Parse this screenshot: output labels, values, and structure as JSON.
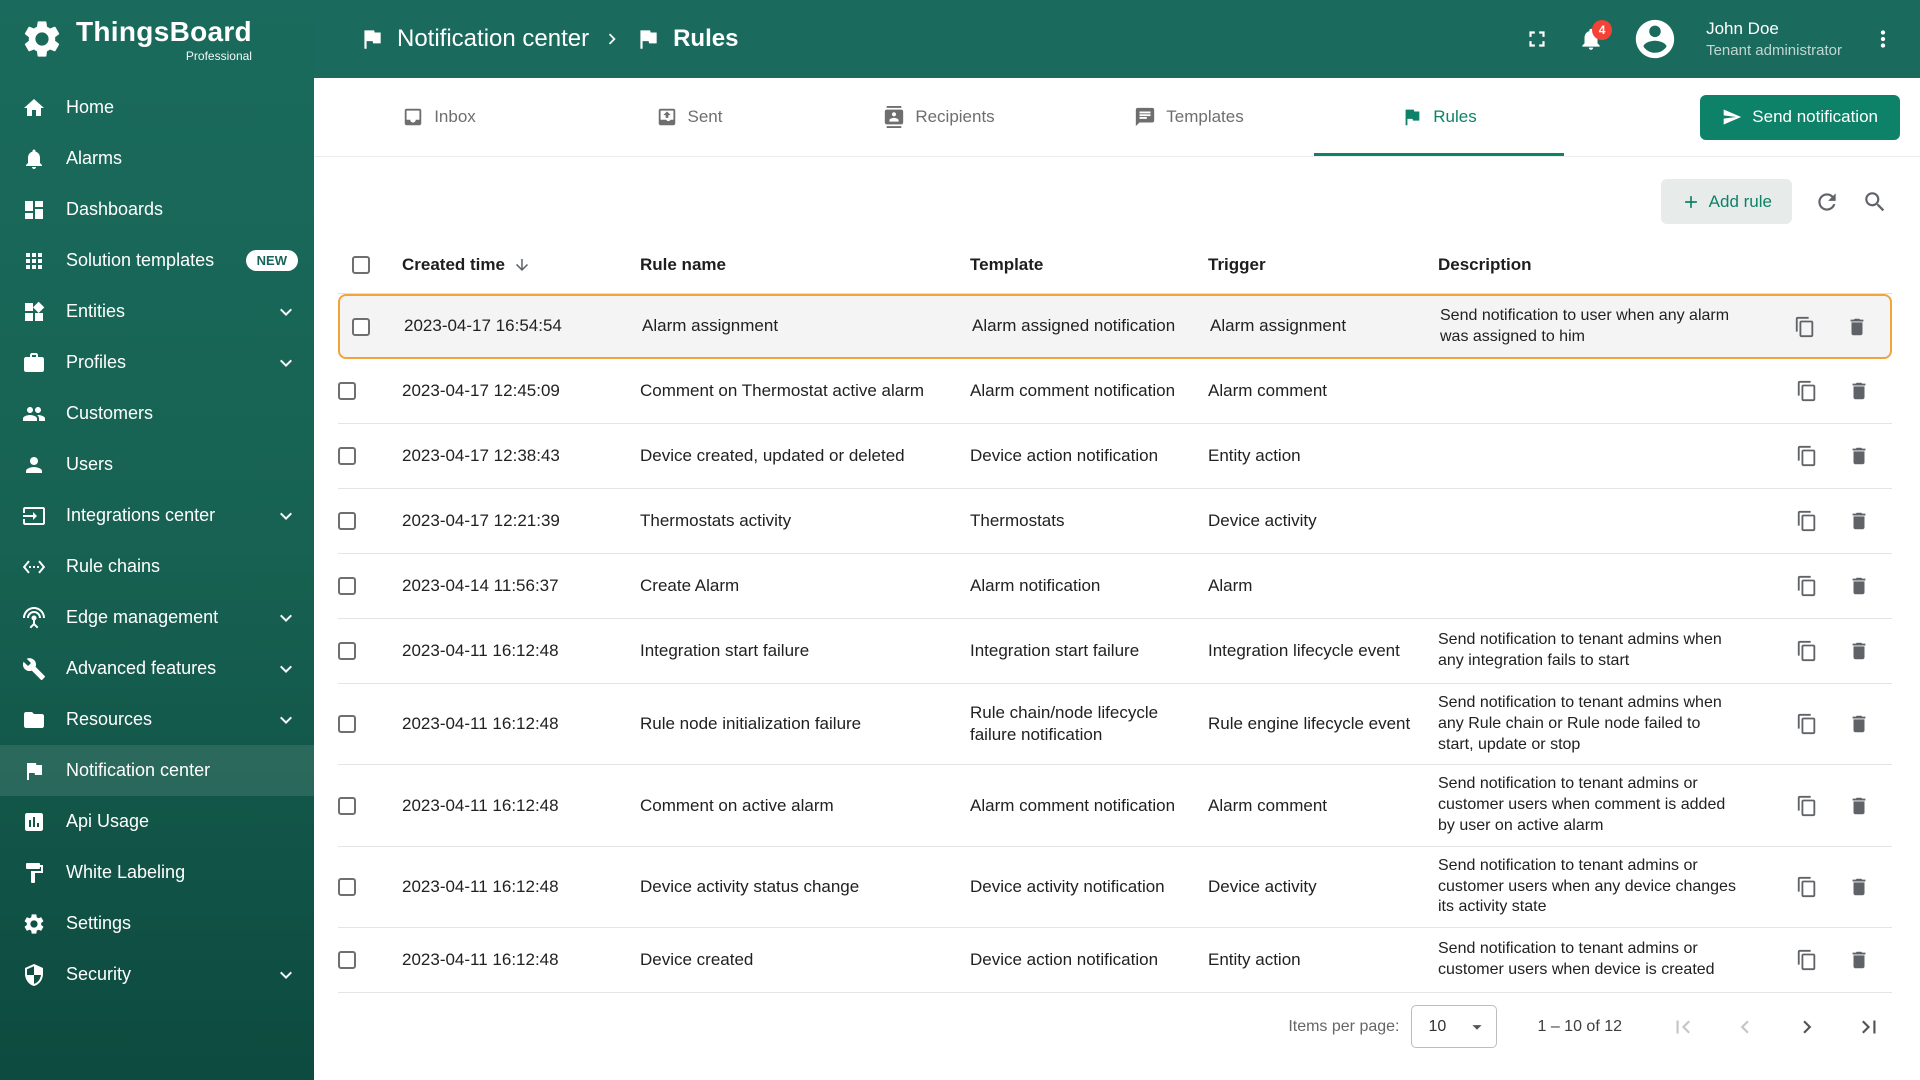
{
  "app": {
    "name": "ThingsBoard",
    "edition": "Professional"
  },
  "colors": {
    "sidebar_green": "#1a6b5d",
    "sidebar_green_dark": "#0d4a3f",
    "accent_green": "#0e8268",
    "highlight_border": "#f1a43c",
    "notification_badge": "#f44336"
  },
  "header": {
    "breadcrumb": [
      {
        "label": "Notification center",
        "icon": "flag"
      },
      {
        "label": "Rules",
        "icon": "rules"
      }
    ],
    "notifications_count": "4",
    "user": {
      "name": "John Doe",
      "role": "Tenant administrator"
    }
  },
  "sidebar": {
    "items": [
      {
        "label": "Home",
        "icon": "home"
      },
      {
        "label": "Alarms",
        "icon": "bell"
      },
      {
        "label": "Dashboards",
        "icon": "dashboard"
      },
      {
        "label": "Solution templates",
        "icon": "apps",
        "badge": "NEW"
      },
      {
        "label": "Entities",
        "icon": "entities",
        "expandable": true
      },
      {
        "label": "Profiles",
        "icon": "briefcase",
        "expandable": true
      },
      {
        "label": "Customers",
        "icon": "people"
      },
      {
        "label": "Users",
        "icon": "person"
      },
      {
        "label": "Integrations center",
        "icon": "integrations",
        "expandable": true
      },
      {
        "label": "Rule chains",
        "icon": "rule-chains"
      },
      {
        "label": "Edge management",
        "icon": "antenna",
        "expandable": true
      },
      {
        "label": "Advanced features",
        "icon": "tools",
        "expandable": true
      },
      {
        "label": "Resources",
        "icon": "folder",
        "expandable": true
      },
      {
        "label": "Notification center",
        "icon": "flag",
        "active": true
      },
      {
        "label": "Api Usage",
        "icon": "chart"
      },
      {
        "label": "White Labeling",
        "icon": "paint"
      },
      {
        "label": "Settings",
        "icon": "gear"
      },
      {
        "label": "Security",
        "icon": "shield",
        "expandable": true
      }
    ]
  },
  "tabs": [
    {
      "label": "Inbox",
      "icon": "inbox"
    },
    {
      "label": "Sent",
      "icon": "outbox"
    },
    {
      "label": "Recipients",
      "icon": "contacts"
    },
    {
      "label": "Templates",
      "icon": "message"
    },
    {
      "label": "Rules",
      "icon": "rules",
      "active": true
    }
  ],
  "actions": {
    "send_notification": "Send notification",
    "add_rule": "Add rule"
  },
  "table": {
    "columns": [
      "Created time",
      "Rule name",
      "Template",
      "Trigger",
      "Description"
    ],
    "sort_column": "Created time",
    "sort_direction": "desc",
    "rows": [
      {
        "created": "2023-04-17 16:54:54",
        "name": "Alarm assignment",
        "template": "Alarm assigned notification",
        "trigger": "Alarm assignment",
        "description": "Send notification to user when any alarm was assigned to him",
        "highlighted": true
      },
      {
        "created": "2023-04-17 12:45:09",
        "name": "Comment on Thermostat active alarm",
        "template": "Alarm comment notification",
        "trigger": "Alarm comment",
        "description": ""
      },
      {
        "created": "2023-04-17 12:38:43",
        "name": "Device created, updated or deleted",
        "template": "Device action notification",
        "trigger": "Entity action",
        "description": ""
      },
      {
        "created": "2023-04-17 12:21:39",
        "name": "Thermostats activity",
        "template": "Thermostats",
        "trigger": "Device activity",
        "description": ""
      },
      {
        "created": "2023-04-14 11:56:37",
        "name": "Create Alarm",
        "template": "Alarm notification",
        "trigger": "Alarm",
        "description": ""
      },
      {
        "created": "2023-04-11 16:12:48",
        "name": "Integration start failure",
        "template": "Integration start failure",
        "trigger": "Integration lifecycle event",
        "description": "Send notification to tenant admins when any integration fails to start"
      },
      {
        "created": "2023-04-11 16:12:48",
        "name": "Rule node initialization failure",
        "template": "Rule chain/node lifecycle failure notification",
        "trigger": "Rule engine lifecycle event",
        "description": "Send notification to tenant admins when any Rule chain or Rule node failed to start, update or stop"
      },
      {
        "created": "2023-04-11 16:12:48",
        "name": "Comment on active alarm",
        "template": "Alarm comment notification",
        "trigger": "Alarm comment",
        "description": "Send notification to tenant admins or customer users when comment is added by user on active alarm"
      },
      {
        "created": "2023-04-11 16:12:48",
        "name": "Device activity status change",
        "template": "Device activity notification",
        "trigger": "Device activity",
        "description": "Send notification to tenant admins or customer users when any device changes its activity state"
      },
      {
        "created": "2023-04-11 16:12:48",
        "name": "Device created",
        "template": "Device action notification",
        "trigger": "Entity action",
        "description": "Send notification to tenant admins or customer users when device is created"
      }
    ]
  },
  "pagination": {
    "items_per_page_label": "Items per page:",
    "items_per_page": "10",
    "range": "1 – 10 of 12"
  }
}
